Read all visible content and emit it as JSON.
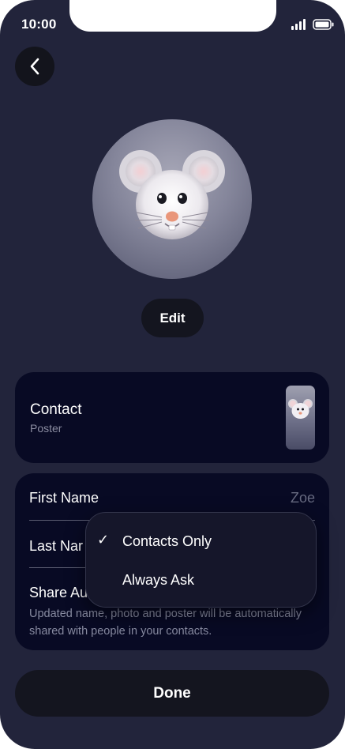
{
  "status_bar": {
    "time": "10:00"
  },
  "header": {
    "back_icon": "chevron-left-icon"
  },
  "profile": {
    "avatar": "mouse-memoji-avatar",
    "edit_label": "Edit"
  },
  "poster_card": {
    "title": "Contact",
    "subtitle": "Poster"
  },
  "form": {
    "first_name_label": "First Name",
    "first_name_value": "Zoe",
    "last_name_label": "Last Nar",
    "share_label": "Share Au",
    "share_description": "Updated name, photo and poster will be automatically shared with people in your contacts."
  },
  "share_menu": {
    "options": [
      {
        "label": "Contacts Only",
        "selected": true
      },
      {
        "label": "Always Ask",
        "selected": false
      }
    ]
  },
  "footer": {
    "done_label": "Done"
  },
  "colors": {
    "background": "#22243b",
    "card": "#080a24",
    "button": "#14151f",
    "secondary_text": "#878aa0"
  }
}
